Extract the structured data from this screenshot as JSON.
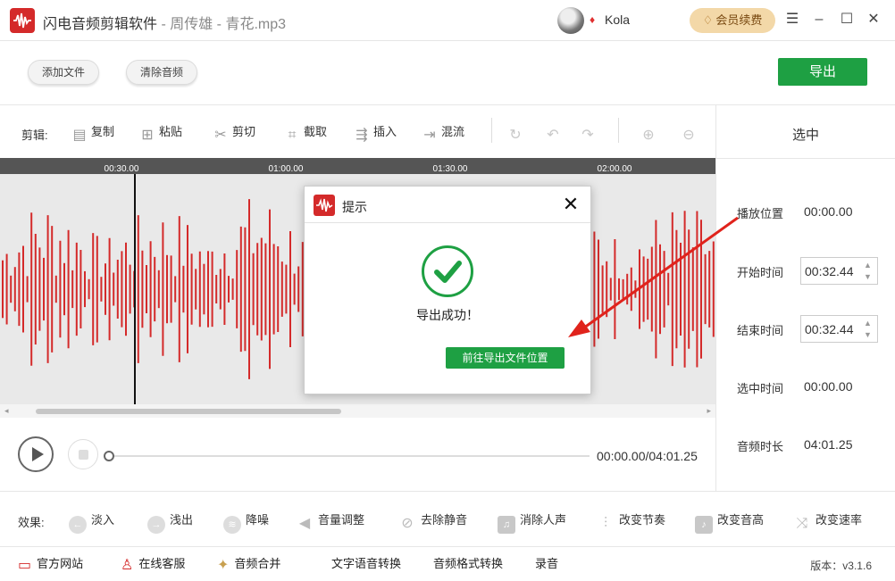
{
  "window": {
    "app_name": "闪电音频剪辑软件",
    "separator": " - ",
    "file_info": "周传雄 - 青花.mp3",
    "username": "Kola",
    "renew_label": "会员续费"
  },
  "toolbar": {
    "add_file": "添加文件",
    "clear_audio": "清除音频",
    "export": "导出"
  },
  "edit": {
    "label": "剪辑:",
    "tools": [
      "复制",
      "粘贴",
      "剪切",
      "截取",
      "插入",
      "混流"
    ]
  },
  "timeline": {
    "ticks": [
      "00:30.00",
      "01:00.00",
      "01:30.00",
      "02:00.00"
    ]
  },
  "selection_panel": {
    "title": "选中",
    "play_position_label": "播放位置",
    "play_position_value": "00:00.00",
    "start_time_label": "开始时间",
    "start_time_value": "00:32.44",
    "end_time_label": "结束时间",
    "end_time_value": "00:32.44",
    "selected_duration_label": "选中时间",
    "selected_duration_value": "00:00.00",
    "audio_duration_label": "音频时长",
    "audio_duration_value": "04:01.25"
  },
  "player": {
    "time": "00:00.00/04:01.25",
    "progress": 0
  },
  "effects": {
    "label": "效果:",
    "items": [
      "淡入",
      "浅出",
      "降噪",
      "音量调整",
      "去除静音",
      "消除人声",
      "改变节奏",
      "改变音高",
      "改变速率"
    ]
  },
  "footer": {
    "links": [
      "官方网站",
      "在线客服",
      "音频合并",
      "文字语音转换",
      "音频格式转换",
      "录音"
    ],
    "version": "版本：v3.1.6"
  },
  "dialog": {
    "title": "提示",
    "message": "导出成功！",
    "button": "前往导出文件位置"
  },
  "colors": {
    "brand_red": "#d42a2a",
    "accent_green": "#1ea043",
    "waveform": "#d42a2a",
    "renew_gold": "#f3d8a8"
  }
}
